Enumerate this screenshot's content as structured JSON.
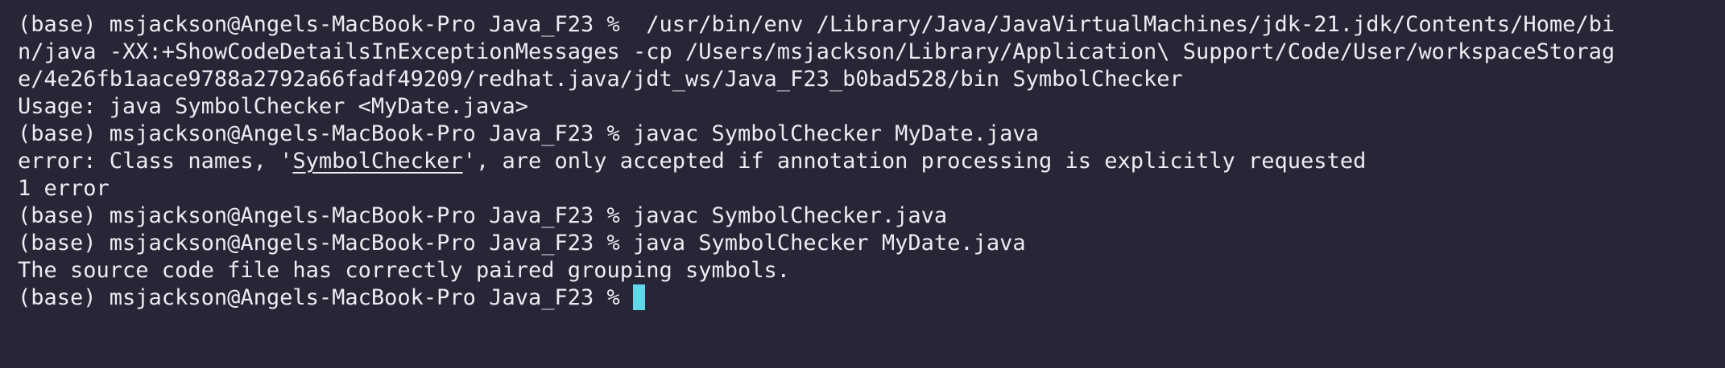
{
  "terminal": {
    "lines": [
      "(base) msjackson@Angels-MacBook-Pro Java_F23 %  /usr/bin/env /Library/Java/JavaVirtualMachines/jdk-21.jdk/Contents/Home/bi",
      "n/java -XX:+ShowCodeDetailsInExceptionMessages -cp /Users/msjackson/Library/Application\\ Support/Code/User/workspaceStorag",
      "e/4e26fb1aace9788a2792a66fadf49209/redhat.java/jdt_ws/Java_F23_b0bad528/bin SymbolChecker",
      "Usage: java SymbolChecker <MyDate.java>",
      "(base) msjackson@Angels-MacBook-Pro Java_F23 % javac SymbolChecker MyDate.java"
    ],
    "error_line": {
      "prefix": "error: Class names, '",
      "link": "SymbolChecker",
      "suffix": "', are only accepted if annotation processing is explicitly requested"
    },
    "lines_after": [
      "1 error",
      "(base) msjackson@Angels-MacBook-Pro Java_F23 % javac SymbolChecker.java",
      "(base) msjackson@Angels-MacBook-Pro Java_F23 % java SymbolChecker MyDate.java",
      "The source code file has correctly paired grouping symbols."
    ],
    "prompt": "(base) msjackson@Angels-MacBook-Pro Java_F23 % ",
    "colors": {
      "background": "#262637",
      "text": "#ECECF2",
      "cursor": "#5FD7E8"
    }
  }
}
